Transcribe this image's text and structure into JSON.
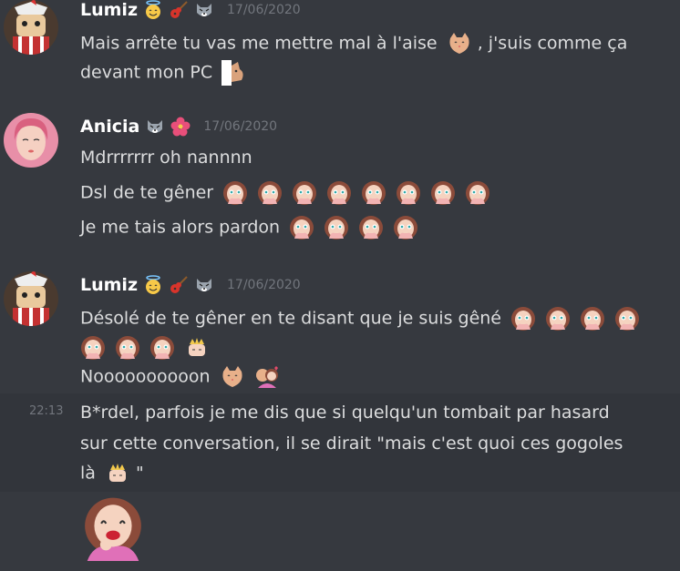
{
  "messages": [
    {
      "username": "Lumiz",
      "timestamp": "17/06/2020",
      "lines": [
        "Mais arrête tu vas me mettre mal à l'aise",
        ", j'suis comme ça",
        "devant mon PC"
      ]
    },
    {
      "username": "Anicia",
      "timestamp": "17/06/2020",
      "lines": [
        "Mdrrrrrrr oh nannnn",
        "Dsl de te gêner",
        "Je me tais alors pardon"
      ]
    },
    {
      "username": "Lumiz",
      "timestamp": "17/06/2020",
      "lines": [
        "Désolé de te gêner en te disant que je suis gêné",
        "Noooooooooon"
      ]
    },
    {
      "hover_time": "22:13",
      "lines": [
        "B*rdel, parfois je me dis que si quelqu'un tombait par hasard",
        "sur cette conversation, il se dirait \"mais c'est quoi ces gogoles",
        "là",
        "\""
      ]
    }
  ]
}
